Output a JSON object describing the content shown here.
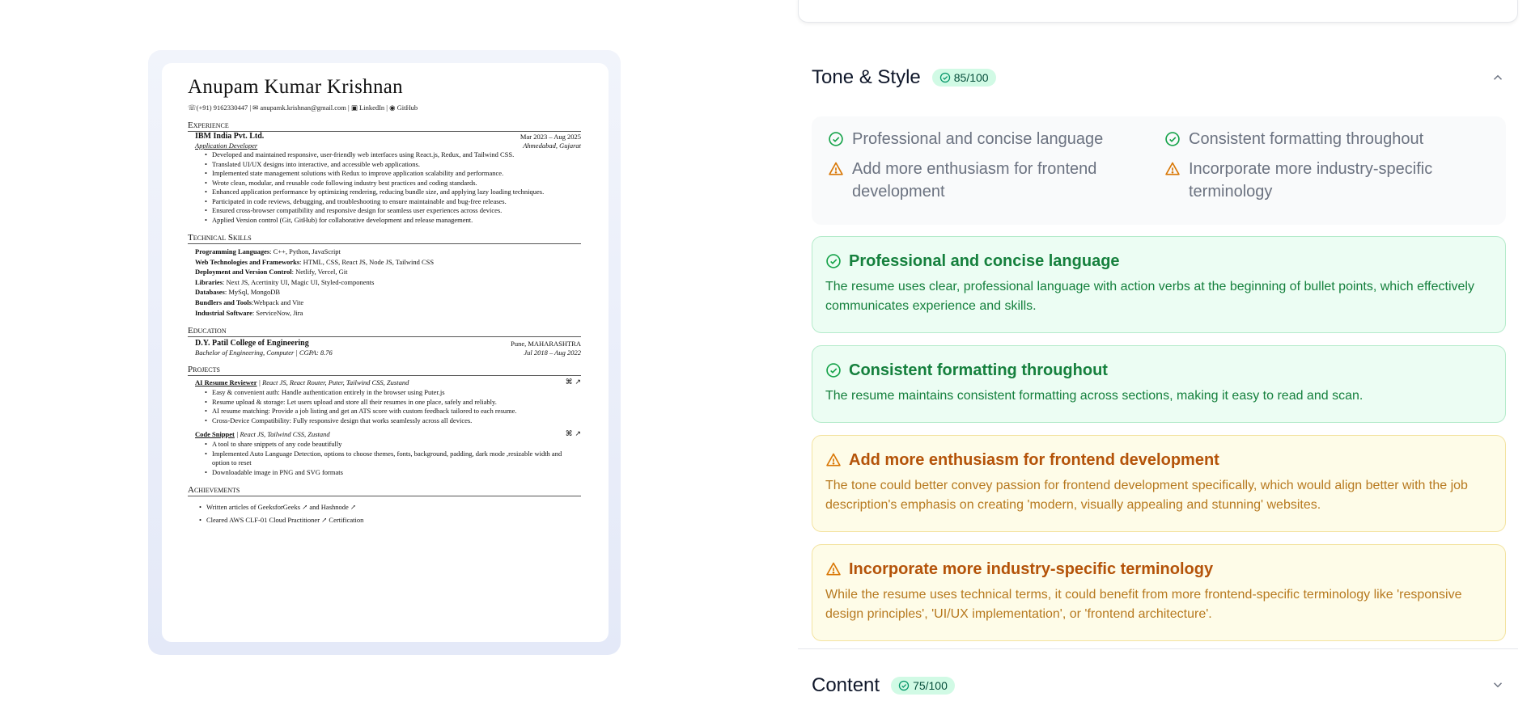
{
  "resume": {
    "name": "Anupam Kumar Krishnan",
    "contact": "☏(+91) 9162330447 | ✉ anupamk.krishnan@gmail.com | ▣ LinkedIn | ◉ GitHub",
    "sections": {
      "experience": "Experience",
      "skills": "Technical Skills",
      "education": "Education",
      "projects": "Projects",
      "achievements": "Achievements"
    },
    "job": {
      "company": "IBM India Pvt. Ltd.",
      "dates": "Mar 2023 – Aug 2025",
      "role": "Application Developer",
      "location": "Ahmedabad, Gujarat",
      "bullets": [
        "Developed and maintained responsive, user-friendly web interfaces using React.js, Redux, and Tailwind CSS.",
        "Translated UI/UX designs into interactive, and accessible web applications.",
        "Implemented state management solutions with Redux to improve application scalability and performance.",
        "Wrote clean, modular, and reusable code following industry best practices and coding standards.",
        "Enhanced application performance by optimizing rendering, reducing bundle size, and applying lazy loading techniques.",
        "Participated in code reviews, debugging, and troubleshooting to ensure maintainable and bug-free releases.",
        "Ensured cross-browser compatibility and responsive design for seamless user experiences across devices.",
        "Applied Version control (Git, GitHub) for collaborative development and release management."
      ]
    },
    "skills": [
      {
        "k": "Programming Languages",
        "v": ": C++, Python, JavaScript"
      },
      {
        "k": "Web Technologies and Frameworks",
        "v": ": HTML, CSS, React JS, Node JS, Tailwind CSS"
      },
      {
        "k": "Deployment and Version Control",
        "v": ": Netlify, Vercel, Git"
      },
      {
        "k": "Libraries",
        "v": ": Next JS, Acertinity UI, Magic UI, Styled-components"
      },
      {
        "k": "Databases",
        "v": ": MySql, MongoDB"
      },
      {
        "k": "Bundlers and Tools",
        "v": ":Webpack and Vite"
      },
      {
        "k": "Industrial Software",
        "v": ": ServiceNow, Jira"
      }
    ],
    "education": {
      "school": "D.Y. Patil College of Engineering",
      "location": "Pune, MAHARASHTRA",
      "degree": "Bachelor of Engineering, Computer | CGPA: 8.76",
      "dates": "Jul 2018 – Aug 2022"
    },
    "projects": [
      {
        "name": "AI Resume Reviewer",
        "tech": " | React JS, React Router, Puter, Tailwind CSS, Zustand",
        "icons": "⌘ ↗",
        "bullets": [
          "Easy & convenient auth: Handle authentication entirely in the browser using Puter.js",
          "Resume upload & storage: Let users upload and store all their resumes in one place, safely and reliably.",
          "AI resume matching: Provide a job listing and get an ATS score with custom feedback tailored to each resume.",
          "Cross-Device Compatibility: Fully responsive design that works seamlessly across all devices."
        ]
      },
      {
        "name": "Code Snippet",
        "tech": " | React JS, Tailwind CSS, Zustand",
        "icons": "⌘ ↗",
        "bullets": [
          "A tool to share snippets of any code beautifully",
          "Implemented Auto Language Detection, options to choose themes, fonts, background, padding, dark mode ,resizable width and option to reset",
          "Downloadable image in PNG and SVG formats"
        ]
      }
    ],
    "achievements": [
      "Written articles of GeeksforGeeks ↗ and Hashnode ↗",
      "Cleared AWS CLF-01 Cloud Practitioner ↗ Certification"
    ]
  },
  "feedback": {
    "tone": {
      "title": "Tone & Style",
      "score": "85/100",
      "summary": [
        {
          "status": "good",
          "text": "Professional and concise language"
        },
        {
          "status": "good",
          "text": "Consistent formatting throughout"
        },
        {
          "status": "warn",
          "text": "Add more enthusiasm for frontend development"
        },
        {
          "status": "warn",
          "text": "Incorporate more industry-specific terminology"
        }
      ],
      "tips": [
        {
          "status": "good",
          "title": "Professional and concise language",
          "body": "The resume uses clear, professional language with action verbs at the beginning of bullet points, which effectively communicates experience and skills."
        },
        {
          "status": "good",
          "title": "Consistent formatting throughout",
          "body": "The resume maintains consistent formatting across sections, making it easy to read and scan."
        },
        {
          "status": "warn",
          "title": "Add more enthusiasm for frontend development",
          "body": "The tone could better convey passion for frontend development specifically, which would align better with the job description's emphasis on creating 'modern, visually appealing and stunning' websites."
        },
        {
          "status": "warn",
          "title": "Incorporate more industry-specific terminology",
          "body": "While the resume uses technical terms, it could benefit from more frontend-specific terminology like 'responsive design principles', 'UI/UX implementation', or 'frontend architecture'."
        }
      ]
    },
    "content": {
      "title": "Content",
      "score": "75/100"
    }
  },
  "colors": {
    "good": "#15803d",
    "warn": "#d97706",
    "badge_bg": "#d1fae5"
  }
}
